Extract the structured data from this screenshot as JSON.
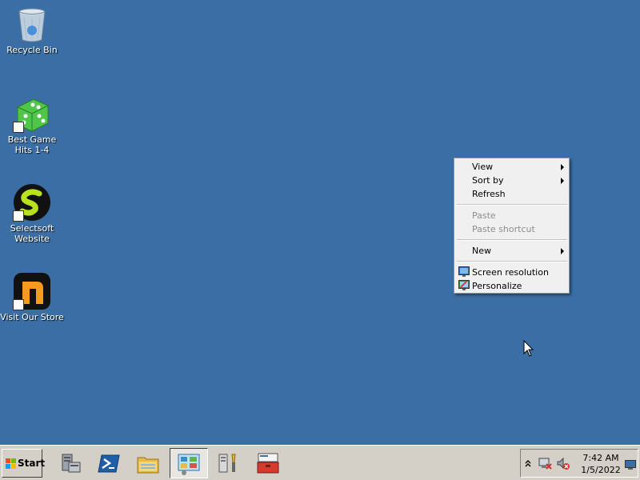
{
  "desktop": {
    "background_color": "#3a6ea5",
    "icons": [
      {
        "label": "Recycle Bin",
        "icon": "recycle-bin-icon"
      },
      {
        "label": "Best Game Hits 1-4",
        "icon": "green-dice-icon"
      },
      {
        "label": "Selectsoft Website",
        "icon": "selectsoft-logo-icon"
      },
      {
        "label": "Visit Our Store",
        "icon": "store-logo-icon"
      }
    ]
  },
  "context_menu": {
    "items": [
      {
        "label": "View",
        "submenu": true,
        "enabled": true
      },
      {
        "label": "Sort by",
        "submenu": true,
        "enabled": true
      },
      {
        "label": "Refresh",
        "enabled": true
      },
      {
        "label": "Paste",
        "enabled": false
      },
      {
        "label": "Paste shortcut",
        "enabled": false
      },
      {
        "label": "New",
        "submenu": true,
        "enabled": true
      },
      {
        "label": "Screen resolution",
        "icon": "monitor-icon",
        "enabled": true
      },
      {
        "label": "Personalize",
        "icon": "personalize-icon",
        "enabled": true
      }
    ]
  },
  "taskbar": {
    "start_label": "Start",
    "buttons": [
      {
        "icon": "server-manager-icon"
      },
      {
        "icon": "powershell-icon"
      },
      {
        "icon": "file-explorer-icon"
      },
      {
        "icon": "control-panel-icon",
        "active": true
      },
      {
        "icon": "tools-icon"
      },
      {
        "icon": "toolbox-icon"
      }
    ],
    "tray": {
      "time": "7:42 AM",
      "date": "1/5/2022",
      "icons": [
        "show-hidden-icons-icon",
        "network-icon",
        "volume-muted-icon",
        "show-desktop-icon"
      ]
    }
  }
}
